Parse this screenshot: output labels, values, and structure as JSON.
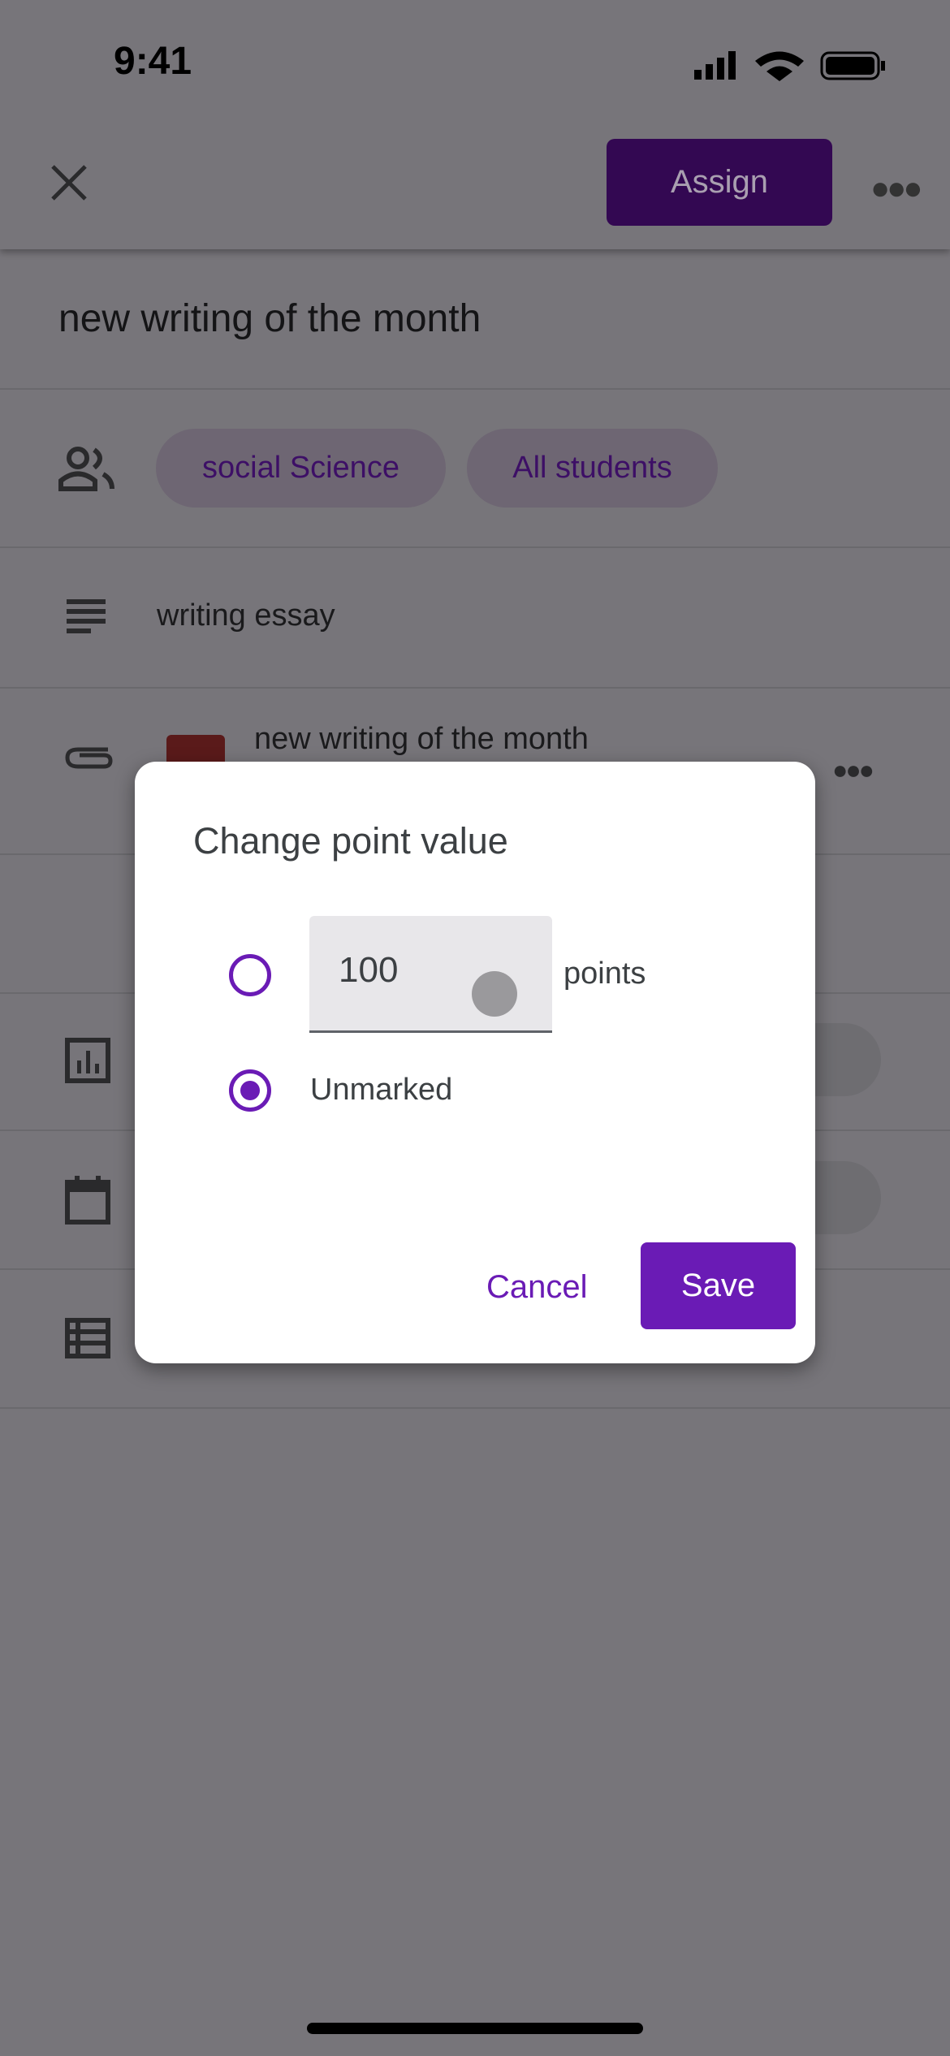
{
  "status_bar": {
    "time": "9:41"
  },
  "header": {
    "assign_label": "Assign"
  },
  "assignment": {
    "title": "new writing of the month",
    "chips": [
      "social Science",
      "All students"
    ],
    "description": "writing essay",
    "attachment": "new writing of the month"
  },
  "dialog": {
    "title": "Change point value",
    "points_value": "100",
    "points_label": "points",
    "unmarked_label": "Unmarked",
    "selected": "Unmarked",
    "cancel_label": "Cancel",
    "save_label": "Save"
  },
  "colors": {
    "accent": "#6a1bb5"
  }
}
